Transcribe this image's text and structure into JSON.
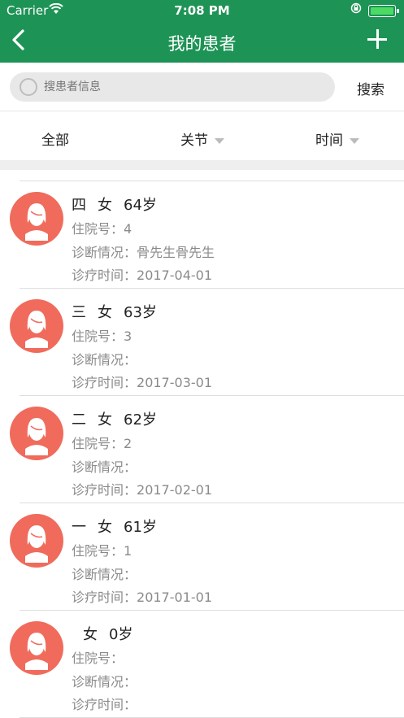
{
  "status_bar": {
    "carrier": "Carrier",
    "time": "7:08 PM"
  },
  "navbar": {
    "title": "我的患者"
  },
  "search": {
    "placeholder": "搜患者信息",
    "button": "搜索"
  },
  "filters": [
    {
      "label": "全部",
      "has_arrow": false
    },
    {
      "label": "关节",
      "has_arrow": true
    },
    {
      "label": "时间",
      "has_arrow": true
    }
  ],
  "labels": {
    "admission": "住院号：",
    "diagnosis": "诊断情况：",
    "treatment_time": "诊疗时间："
  },
  "patients": [
    {
      "name": "四",
      "gender": "女",
      "age": "64岁",
      "admission_no": "4",
      "diagnosis": "骨先生骨先生",
      "date": "2017-04-01"
    },
    {
      "name": "三",
      "gender": "女",
      "age": "63岁",
      "admission_no": "3",
      "diagnosis": "",
      "date": "2017-03-01"
    },
    {
      "name": "二",
      "gender": "女",
      "age": "62岁",
      "admission_no": "2",
      "diagnosis": "",
      "date": "2017-02-01"
    },
    {
      "name": "一",
      "gender": "女",
      "age": "61岁",
      "admission_no": "1",
      "diagnosis": "",
      "date": "2017-01-01"
    },
    {
      "name": "",
      "gender": "女",
      "age": "0岁",
      "admission_no": "",
      "diagnosis": "",
      "date": ""
    }
  ],
  "colors": {
    "header": "#1e9356",
    "avatar": "#f06b5c"
  }
}
